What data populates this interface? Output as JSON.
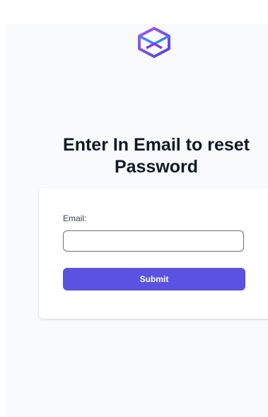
{
  "logo": {
    "icon": "hexagon-cube-logo-icon",
    "colors": [
      "#7c3aed",
      "#4f8df7"
    ]
  },
  "heading": {
    "line1": "Enter In Email to reset",
    "line2": "Password"
  },
  "form": {
    "email_label": "Email:",
    "email_value": "",
    "submit_label": "Submit"
  },
  "colors": {
    "accent": "#5b52e1",
    "background": "#f9fafb",
    "text": "#111827"
  }
}
